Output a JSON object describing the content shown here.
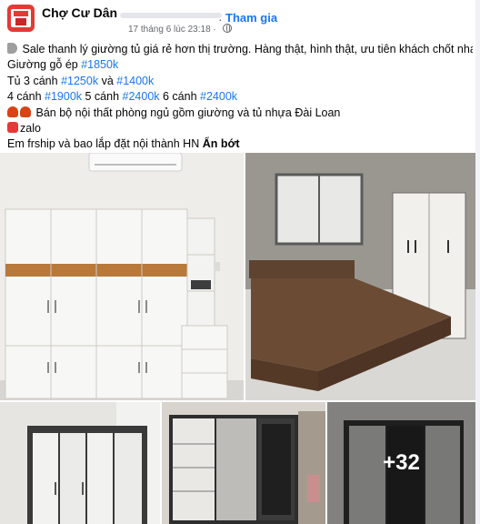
{
  "post": {
    "group_name": "Chợ Cư Dân",
    "join_label": "Tham gia",
    "timestamp": "17 tháng 6 lúc 23:18",
    "separator": "·",
    "lines": {
      "l1_text": "Sale thanh lý giường tủ giá rẻ hơn thị trường. Hàng thật, hình thật, ưu tiên khách chốt nhanh.",
      "l2_text": "Giường gỗ ép ",
      "l2_tag": "#1850k",
      "l3_text1": "Tủ 3 cánh ",
      "l3_tag1": "#1250k",
      "l3_text2": " và ",
      "l3_tag2": "#1400k",
      "l4_text1": "4 cánh ",
      "l4_tag1": "#1900k",
      "l4_text2": " 5 cánh ",
      "l4_tag2": "#2400k",
      "l4_text3": " 6 cánh ",
      "l4_tag3": "#2400k",
      "l5_text": "Bán bộ nội thất phòng ngủ gồm giường và tủ nhựa Đài Loan",
      "l6_text": "zalo",
      "l7_text": "Em frship và bao lắp đặt nội thành HN ",
      "see_less": "Ẩn bớt"
    },
    "more_photos": "+32"
  },
  "colors": {
    "link": "#1877f2",
    "text": "#050505",
    "secondary": "#65676b",
    "brand_red": "#e53935"
  },
  "icons": [
    "globe-icon",
    "speaker-icon",
    "person-icon",
    "phone-icon"
  ]
}
